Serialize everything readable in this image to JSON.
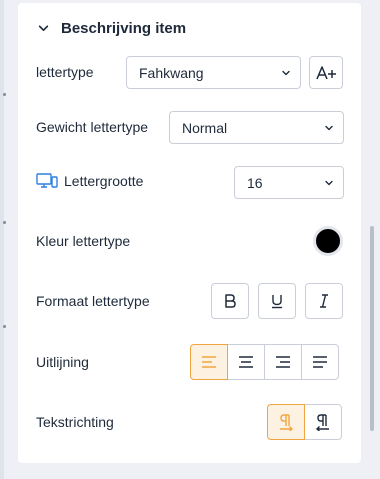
{
  "section": {
    "title": "Beschrijving item"
  },
  "font": {
    "label": "lettertype",
    "value": "Fahkwang",
    "add_icon": "font-add-icon"
  },
  "weight": {
    "label": "Gewicht lettertype",
    "value": "Normal"
  },
  "size": {
    "label": "Lettergrootte",
    "value": "16",
    "device_icon": "desktop-icon"
  },
  "color": {
    "label": "Kleur lettertype",
    "value": "#000000"
  },
  "format": {
    "label": "Formaat lettertype",
    "buttons": [
      "bold-icon",
      "underline-icon",
      "italic-icon"
    ]
  },
  "align": {
    "label": "Uitlijning",
    "options": [
      "align-left-icon",
      "align-center-icon",
      "align-right-icon",
      "align-justify-icon"
    ],
    "selected": "align-left-icon"
  },
  "direction": {
    "label": "Tekstrichting",
    "options": [
      "ltr-icon",
      "rtl-icon"
    ],
    "selected": "ltr-icon"
  },
  "colors": {
    "accent": "#f0a640",
    "accent_bg": "#fdf2e2",
    "desktop_icon": "#2f7fe0",
    "text": "#1e2a3a"
  }
}
